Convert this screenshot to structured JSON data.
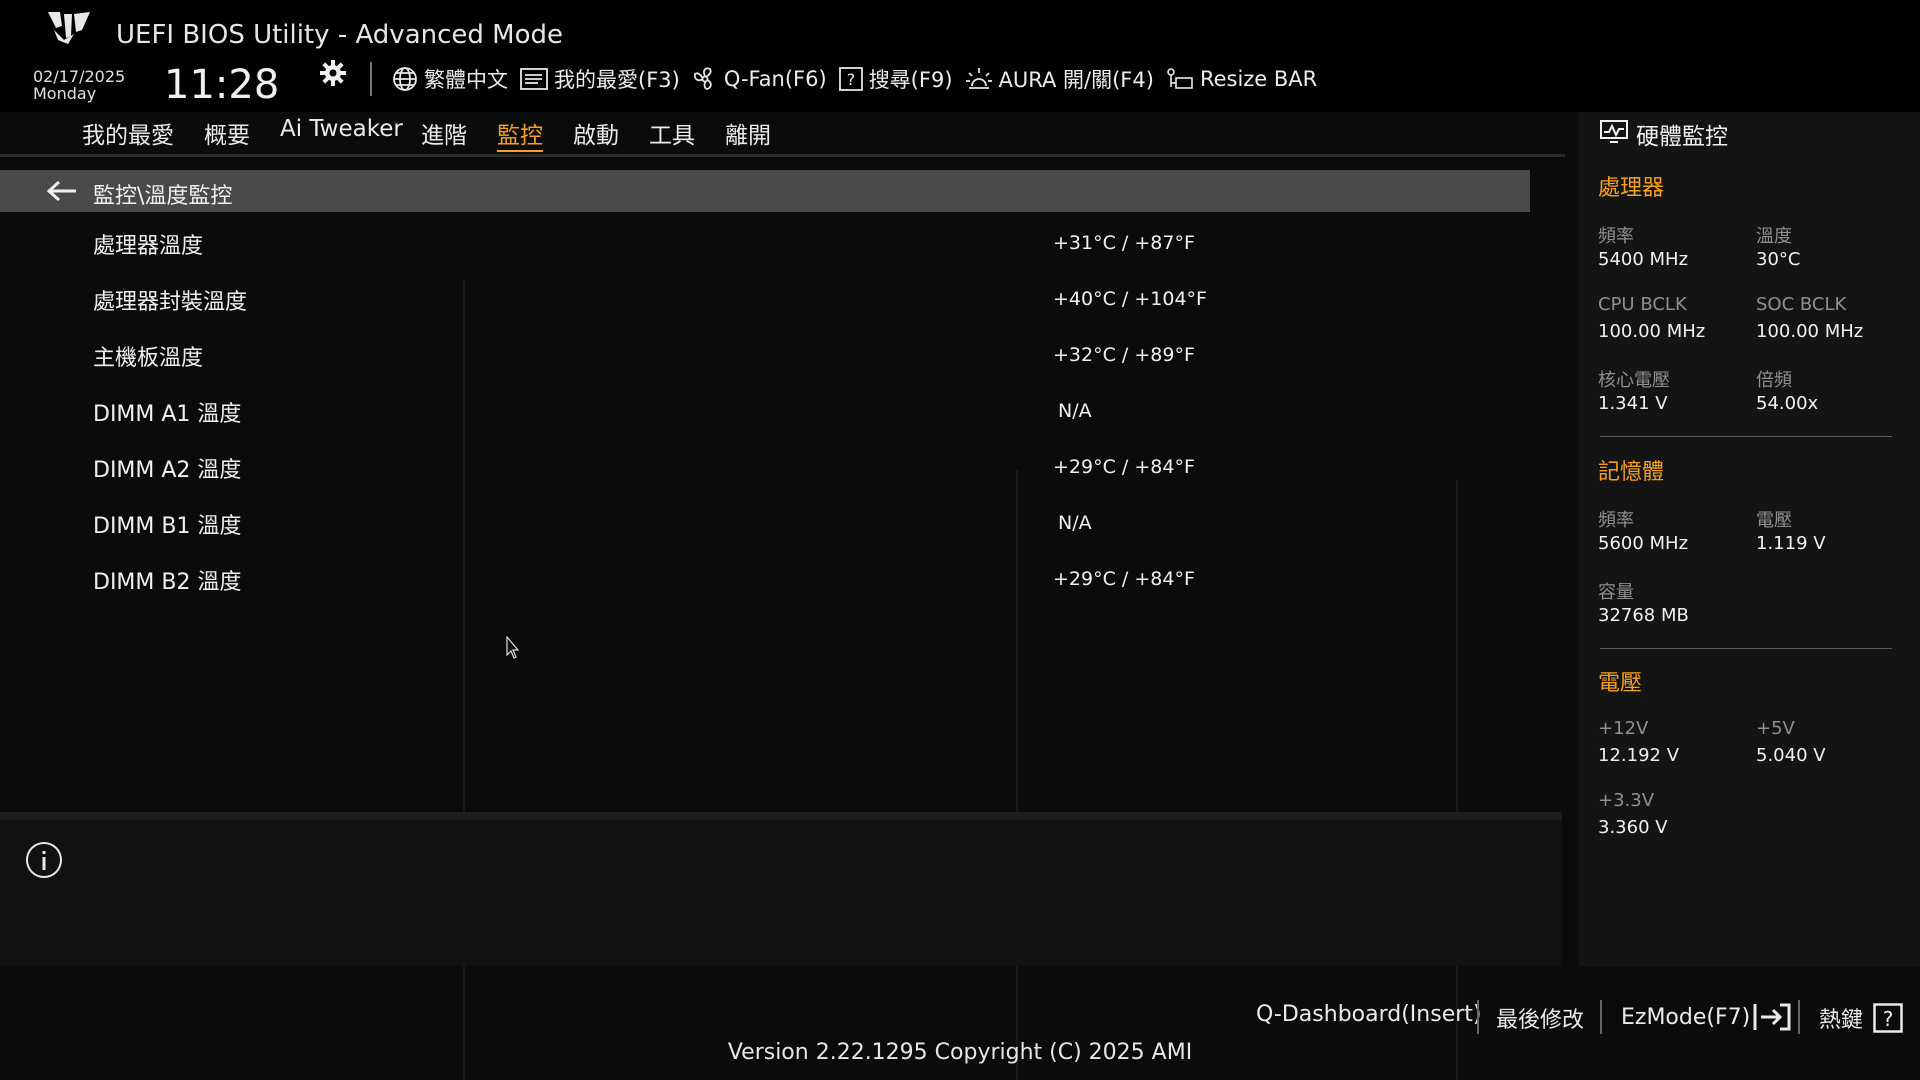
{
  "header": {
    "title": "UEFI BIOS Utility - Advanced Mode",
    "date": "02/17/2025",
    "weekday": "Monday",
    "time": "11:28"
  },
  "toolbar": {
    "language": "繁體中文",
    "favorites": "我的最愛(F3)",
    "qfan": "Q-Fan(F6)",
    "search": "搜尋(F9)",
    "aura": "AURA 開/關(F4)",
    "resize_bar": "Resize BAR"
  },
  "menu": {
    "items": [
      "我的最愛",
      "概要",
      "Ai Tweaker",
      "進階",
      "監控",
      "啟動",
      "工具",
      "離開"
    ],
    "active": "監控"
  },
  "breadcrumb": "監控\\溫度監控",
  "rows": [
    {
      "label": "處理器溫度",
      "value": "+31°C / +87°F"
    },
    {
      "label": "處理器封裝溫度",
      "value": "+40°C / +104°F"
    },
    {
      "label": "主機板溫度",
      "value": "+32°C / +89°F"
    },
    {
      "label": "DIMM A1 溫度",
      "value": "N/A"
    },
    {
      "label": "DIMM A2 溫度",
      "value": "+29°C / +84°F"
    },
    {
      "label": "DIMM B1 溫度",
      "value": "N/A"
    },
    {
      "label": "DIMM B2 溫度",
      "value": "+29°C / +84°F"
    }
  ],
  "hw_monitor": {
    "title": "硬體監控",
    "cpu": {
      "heading": "處理器",
      "freq_label": "頻率",
      "freq": "5400 MHz",
      "temp_label": "溫度",
      "temp": "30°C",
      "bclk_label": "CPU BCLK",
      "bclk": "100.00 MHz",
      "soc_label": "SOC BCLK",
      "soc": "100.00 MHz",
      "vcore_label": "核心電壓",
      "vcore": "1.341 V",
      "ratio_label": "倍頻",
      "ratio": "54.00x"
    },
    "memory": {
      "heading": "記憶體",
      "freq_label": "頻率",
      "freq": "5600 MHz",
      "volt_label": "電壓",
      "volt": "1.119 V",
      "cap_label": "容量",
      "cap": "32768 MB"
    },
    "voltage": {
      "heading": "電壓",
      "v12_label": "+12V",
      "v12": "12.192 V",
      "v5_label": "+5V",
      "v5": "5.040 V",
      "v33_label": "+3.3V",
      "v33": "3.360 V"
    }
  },
  "footer": {
    "qdashboard": "Q-Dashboard(Insert)",
    "last_modified": "最後修改",
    "ezmode": "EzMode(F7)",
    "hotkeys": "熱鍵",
    "version": "Version 2.22.1295 Copyright (C) 2025 AMI"
  },
  "colors": {
    "accent": "#f7a11a",
    "background": "#0b0b0b",
    "breadcrumb_bg": "#4a4a4a"
  }
}
